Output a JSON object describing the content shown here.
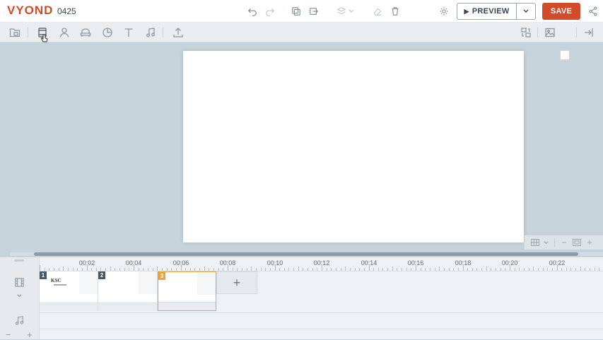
{
  "app": {
    "logo": "VYOND",
    "project_name": "0425"
  },
  "topbar": {
    "preview_label": "PREVIEW",
    "save_label": "SAVE"
  },
  "colors": {
    "accent": "#d24b2a",
    "active_scene": "#e8a33d",
    "workspace_bg": "#c6d3da"
  },
  "toolbar_icons": [
    "folder-icon",
    "scene-templates-icon",
    "character-icon",
    "props-icon",
    "chart-icon",
    "text-icon",
    "audio-icon",
    "upload-icon"
  ],
  "timeline": {
    "ruler_labels": [
      "00:02",
      "00:04",
      "00:06",
      "00:08",
      "00:10",
      "00:12",
      "00:14",
      "00:16",
      "00:18",
      "00:20",
      "00:22"
    ],
    "scenes": [
      {
        "number": "1",
        "thumb_text": "KSC"
      },
      {
        "number": "2",
        "thumb_text": ""
      },
      {
        "number": "3",
        "thumb_text": ""
      }
    ],
    "add_scene_label": "+"
  }
}
